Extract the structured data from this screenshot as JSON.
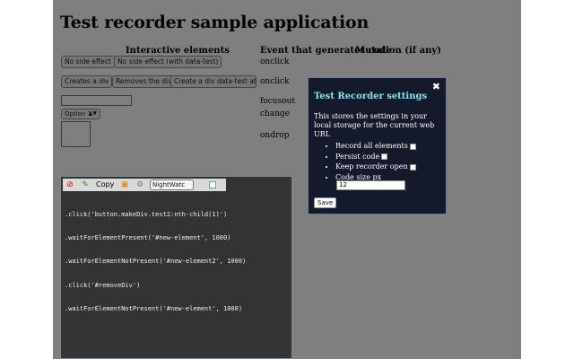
{
  "page": {
    "title": "Test recorder sample application",
    "columns": [
      "Interactive elements",
      "Event that generates code",
      "Mutation (if any)"
    ],
    "buttons": {
      "no_side_effect": "No side effect",
      "no_side_effect_data_test": "No side effect (with data-test)",
      "create_div": "Creates a div",
      "remove_div": "Removes the div",
      "create_div_data_test": "Create a div data-test attr="
    },
    "events": {
      "row1": "onclick",
      "row2": "onclick",
      "row3": "focusout",
      "row4": "change",
      "row5": "ondrop"
    },
    "select_value": "Option 1"
  },
  "recorder": {
    "copy_label": "Copy",
    "format_value": "NightWatc",
    "icons": {
      "clear": "no-entry-icon",
      "pick": "crayon-icon",
      "camera": "camera-icon",
      "settings": "gear-icon"
    },
    "code_lines": [
      ".click('button.makeDiv.test2:nth-child(1)')",
      ".waitForElementPresent('#new-element', 1000)",
      ".waitForElementNotPresent('#new-element2', 1000)",
      ".click('#removeDiv')",
      ".waitForElementNotPresent('#new-element', 1000)"
    ]
  },
  "settings": {
    "title": "Test Recorder settings",
    "close_label": "✖",
    "description": "This stores the settings in your local storage for the current web URL",
    "options": {
      "record_all": "Record all elements",
      "persist_code": "Persist code",
      "keep_open": "Keep recorder open",
      "code_size": "Code size px"
    },
    "code_size_value": "12",
    "save_label": "Save"
  },
  "colors": {
    "overlay": "rgba(0,0,0,0.5)",
    "modal_bg": "#141a2c",
    "modal_title": "#8de0ef",
    "recorder_bg": "#333333"
  }
}
